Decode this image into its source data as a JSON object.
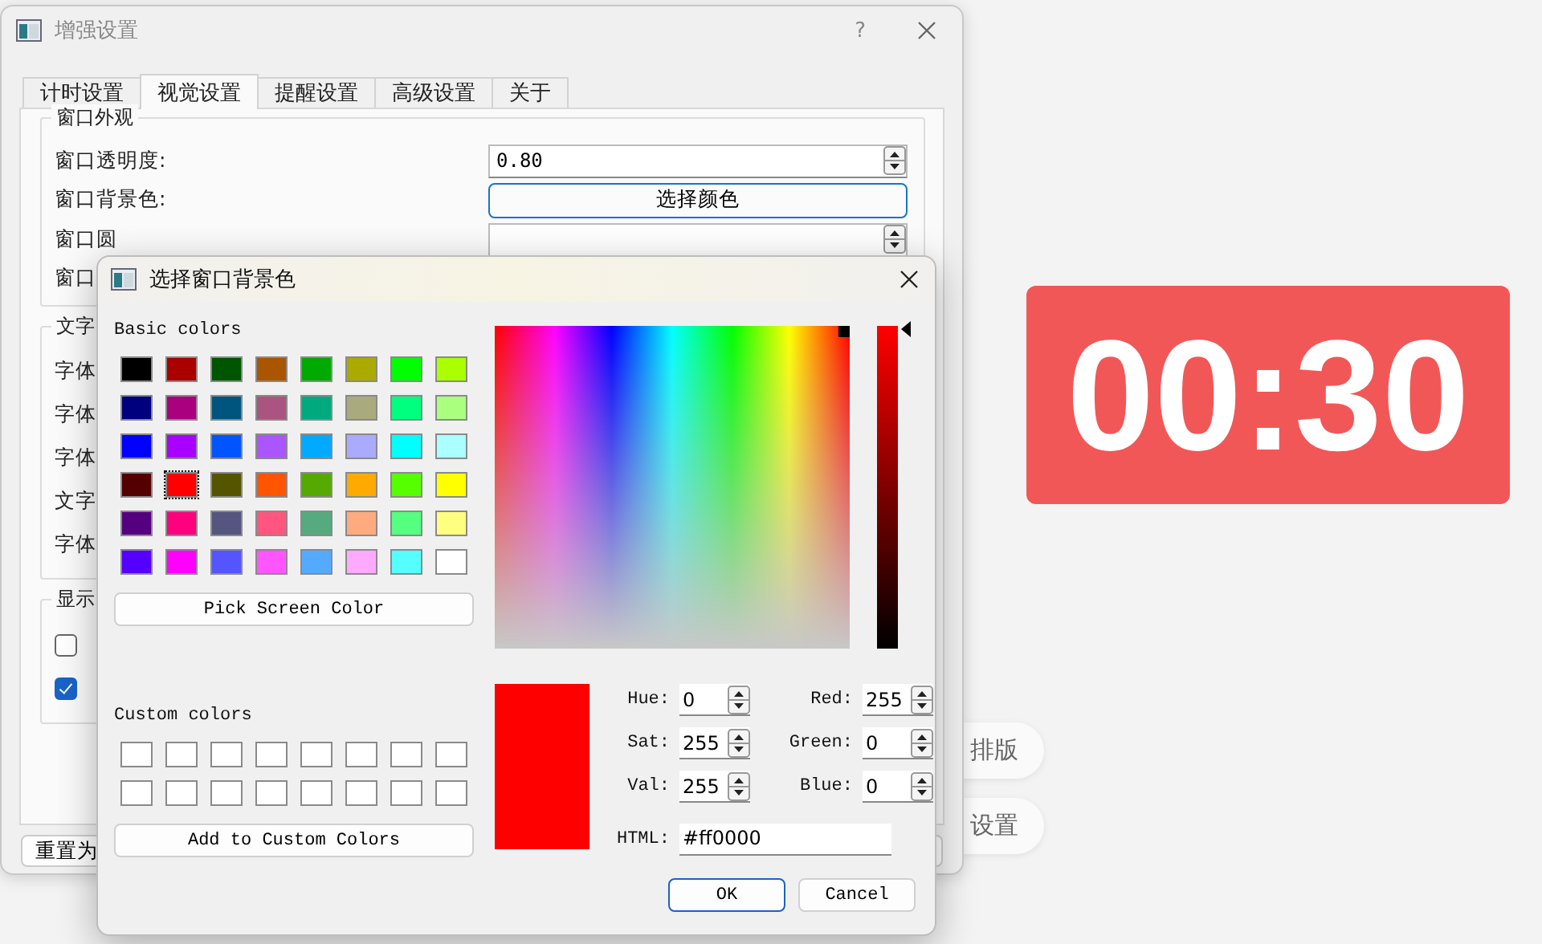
{
  "background_app": {
    "timer": {
      "text": "00:30",
      "color": "#f25757"
    },
    "pills": [
      {
        "label": "排版"
      },
      {
        "label": "设置"
      }
    ]
  },
  "settings_window": {
    "title": "增强设置",
    "help": "?",
    "tabs": [
      {
        "label": "计时设置",
        "selected": false
      },
      {
        "label": "视觉设置",
        "selected": true
      },
      {
        "label": "提醒设置",
        "selected": false
      },
      {
        "label": "高级设置",
        "selected": false
      },
      {
        "label": "关于",
        "selected": false
      }
    ],
    "groups": [
      {
        "title": "窗口外观",
        "rows": [
          {
            "label": "窗口透明度:",
            "kind": "spin",
            "value": "0.80"
          },
          {
            "label": "窗口背景色:",
            "kind": "button",
            "value": "选择颜色"
          },
          {
            "label": "窗口圆",
            "kind": "hidden"
          },
          {
            "label": "窗口",
            "kind": "hidden"
          }
        ]
      },
      {
        "title": "文字",
        "rows": [
          {
            "label": "字体",
            "kind": "hidden"
          },
          {
            "label": "字体",
            "kind": "hidden"
          },
          {
            "label": "字体",
            "kind": "hidden"
          },
          {
            "label": "文字",
            "kind": "hidden"
          },
          {
            "label": "字体",
            "kind": "hidden"
          }
        ]
      },
      {
        "title": "显示",
        "rows": [
          {
            "kind": "check",
            "checked": false
          },
          {
            "kind": "check",
            "checked": true
          }
        ]
      }
    ],
    "reset_button": "重置为"
  },
  "color_dialog": {
    "title": "选择窗口背景色",
    "basic_label": "Basic colors",
    "basic_colors": [
      {
        "color": "#000000",
        "selected": false
      },
      {
        "color": "#aa0000",
        "selected": false
      },
      {
        "color": "#005500",
        "selected": false
      },
      {
        "color": "#aa5500",
        "selected": false
      },
      {
        "color": "#00aa00",
        "selected": false
      },
      {
        "color": "#aaaa00",
        "selected": false
      },
      {
        "color": "#00ff00",
        "selected": false
      },
      {
        "color": "#aaff00",
        "selected": false
      },
      {
        "color": "#00007f",
        "selected": false
      },
      {
        "color": "#aa007f",
        "selected": false
      },
      {
        "color": "#00557f",
        "selected": false
      },
      {
        "color": "#aa557f",
        "selected": false
      },
      {
        "color": "#00aa7f",
        "selected": false
      },
      {
        "color": "#aaaa7f",
        "selected": false
      },
      {
        "color": "#00ff7f",
        "selected": false
      },
      {
        "color": "#aaff7f",
        "selected": false
      },
      {
        "color": "#0000ff",
        "selected": false
      },
      {
        "color": "#aa00ff",
        "selected": false
      },
      {
        "color": "#0055ff",
        "selected": false
      },
      {
        "color": "#aa55ff",
        "selected": false
      },
      {
        "color": "#00aaff",
        "selected": false
      },
      {
        "color": "#aaaaff",
        "selected": false
      },
      {
        "color": "#00ffff",
        "selected": false
      },
      {
        "color": "#aaffff",
        "selected": false
      },
      {
        "color": "#550000",
        "selected": false
      },
      {
        "color": "#ff0000",
        "selected": true
      },
      {
        "color": "#555500",
        "selected": false
      },
      {
        "color": "#ff5500",
        "selected": false
      },
      {
        "color": "#55aa00",
        "selected": false
      },
      {
        "color": "#ffaa00",
        "selected": false
      },
      {
        "color": "#55ff00",
        "selected": false
      },
      {
        "color": "#ffff00",
        "selected": false
      },
      {
        "color": "#55007f",
        "selected": false
      },
      {
        "color": "#ff007f",
        "selected": false
      },
      {
        "color": "#55557f",
        "selected": false
      },
      {
        "color": "#ff557f",
        "selected": false
      },
      {
        "color": "#55aa7f",
        "selected": false
      },
      {
        "color": "#ffaa7f",
        "selected": false
      },
      {
        "color": "#55ff7f",
        "selected": false
      },
      {
        "color": "#ffff7f",
        "selected": false
      },
      {
        "color": "#5500ff",
        "selected": false
      },
      {
        "color": "#ff00ff",
        "selected": false
      },
      {
        "color": "#5555ff",
        "selected": false
      },
      {
        "color": "#ff55ff",
        "selected": false
      },
      {
        "color": "#55aaff",
        "selected": false
      },
      {
        "color": "#ffaaff",
        "selected": false
      },
      {
        "color": "#55ffff",
        "selected": false
      },
      {
        "color": "#ffffff",
        "selected": false
      }
    ],
    "pick_button": "Pick Screen Color",
    "custom_label": "Custom colors",
    "add_button": "Add to Custom Colors",
    "value_slider": {
      "level": 1
    },
    "current_color": {
      "color": "#ff0000"
    },
    "fields": [
      {
        "label": "Hue:",
        "value": "0"
      },
      {
        "label": "Red:",
        "value": "255"
      },
      {
        "label": "Sat:",
        "value": "255"
      },
      {
        "label": "Green:",
        "value": "0"
      },
      {
        "label": "Val:",
        "value": "255"
      },
      {
        "label": "Blue:",
        "value": "0"
      }
    ],
    "html": {
      "label": "HTML:",
      "value": "#ff0000"
    },
    "buttons": [
      {
        "label": "OK",
        "kind": "default"
      },
      {
        "label": "Cancel",
        "kind": "normal"
      }
    ]
  }
}
